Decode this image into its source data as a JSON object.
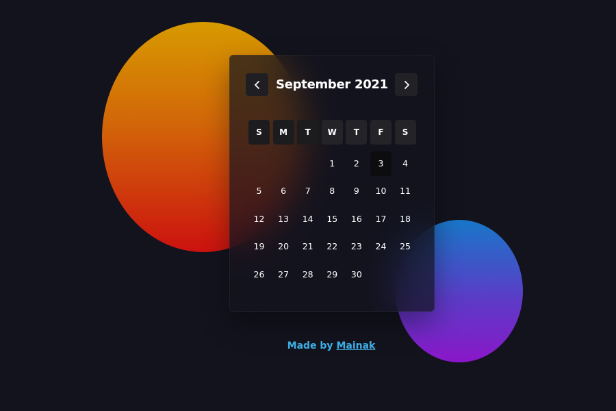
{
  "calendar": {
    "month_title": "September 2021",
    "prev_icon": "chevron-left-icon",
    "next_icon": "chevron-right-icon",
    "weekdays": [
      "S",
      "M",
      "T",
      "W",
      "T",
      "F",
      "S"
    ],
    "leading_blanks": 3,
    "days": [
      "1",
      "2",
      "3",
      "4",
      "5",
      "6",
      "7",
      "8",
      "9",
      "10",
      "11",
      "12",
      "13",
      "14",
      "15",
      "16",
      "17",
      "18",
      "19",
      "20",
      "21",
      "22",
      "23",
      "24",
      "25",
      "26",
      "27",
      "28",
      "29",
      "30"
    ],
    "highlighted_day": "3"
  },
  "footer": {
    "prefix": "Made by ",
    "author": "Mainak"
  },
  "colors": {
    "background": "#13131e",
    "accent": "#3eaee6",
    "orange_blob_top": "#d79a00",
    "orange_blob_bottom": "#cc120f",
    "purple_blob_top": "#1877c8",
    "purple_blob_bottom": "#8a17c9"
  }
}
